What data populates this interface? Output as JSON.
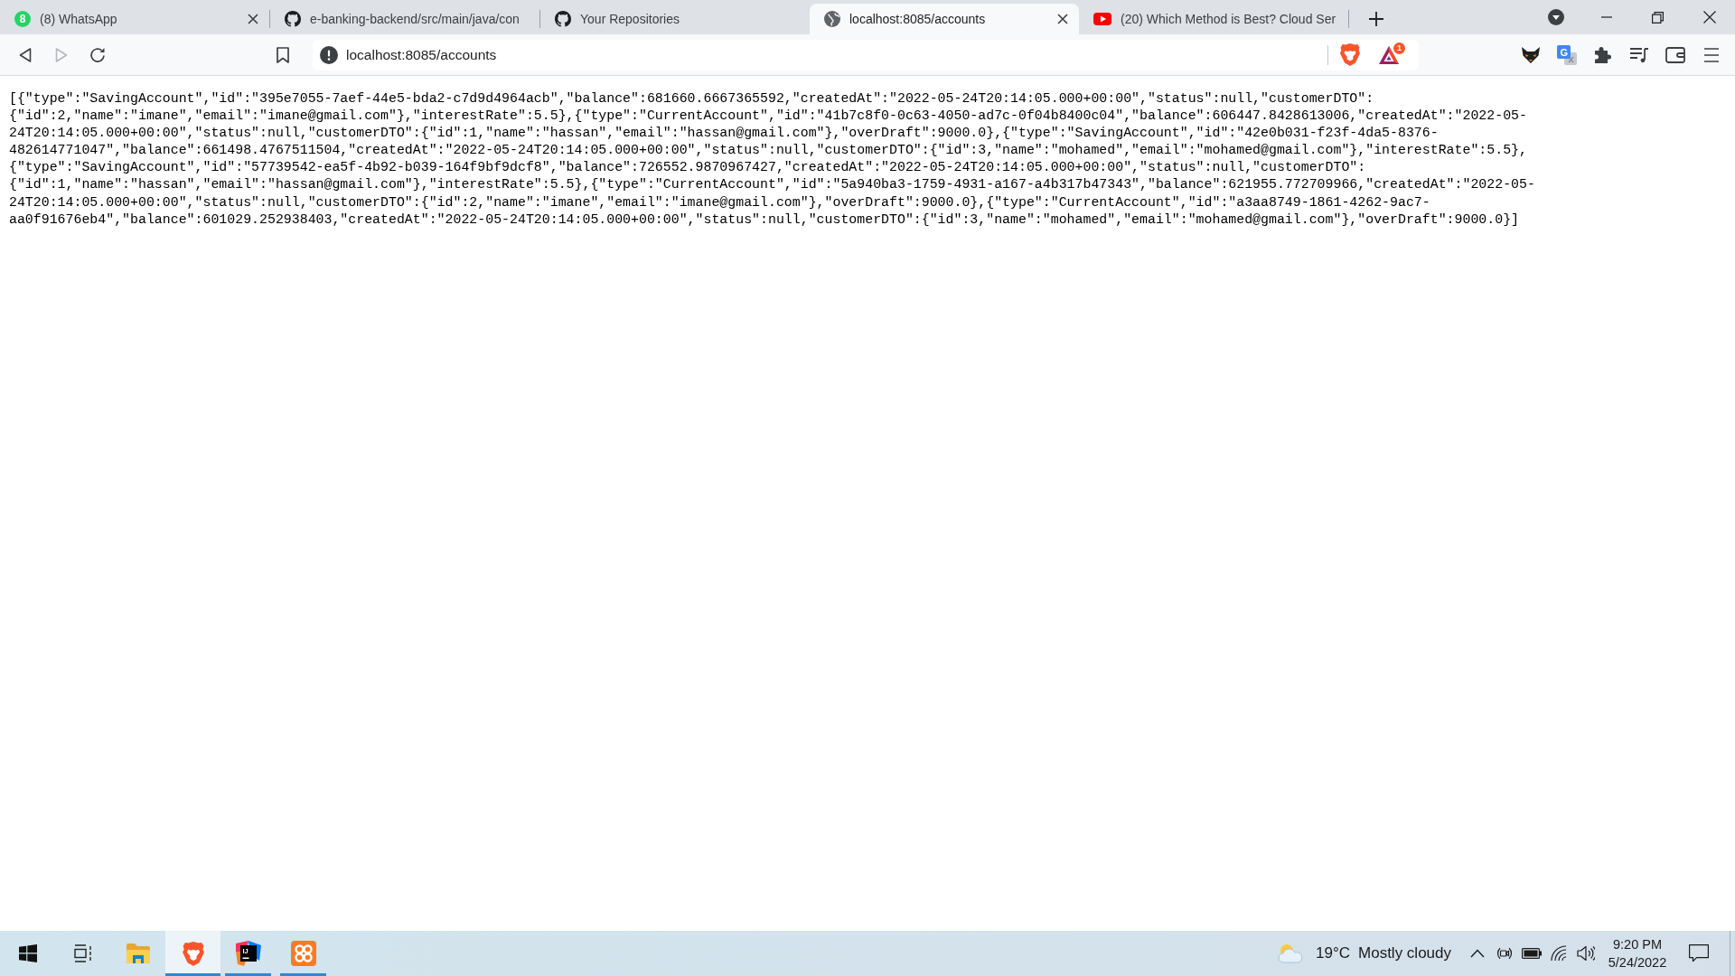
{
  "tabs": [
    {
      "kind": "whatsapp",
      "badge": "8",
      "title": "(8) WhatsApp",
      "selected": false,
      "closable": true
    },
    {
      "kind": "github",
      "title": "e-banking-backend/src/main/java/con",
      "selected": false,
      "closable": false
    },
    {
      "kind": "github",
      "title": "Your Repositories",
      "selected": false,
      "closable": false
    },
    {
      "kind": "globe",
      "title": "localhost:8085/accounts",
      "selected": true,
      "closable": true
    },
    {
      "kind": "youtube",
      "title": "(20) Which Method is Best? Cloud Ser",
      "selected": false,
      "closable": false
    }
  ],
  "toolbar": {
    "navigation": [
      {
        "kind": "back",
        "disabled": false
      },
      {
        "kind": "forward",
        "disabled": true
      },
      {
        "kind": "reload",
        "disabled": false
      }
    ],
    "address": {
      "value": "localhost:8085/accounts"
    },
    "rewards_badge": "1",
    "extensions": [
      {
        "kind": "fox"
      },
      {
        "kind": "translate",
        "icon_text": "G"
      },
      {
        "kind": "puzzle"
      },
      {
        "kind": "playlist"
      },
      {
        "kind": "wallet"
      },
      {
        "kind": "menu"
      }
    ]
  },
  "page": {
    "lines": [
      "[{\"type\":\"SavingAccount\",\"id\":\"395e7055-7aef-44e5-bda2-c7d9d4964acb\",\"balance\":681660.6667365592,\"createdAt\":\"2022-05-24T20:14:05.000+00:00\",\"status\":null,\"customerDTO\":",
      "{\"id\":2,\"name\":\"imane\",\"email\":\"imane@gmail.com\"},\"interestRate\":5.5},{\"type\":\"CurrentAccount\",\"id\":\"41b7c8f0-0c63-4050-ad7c-0f04b8400c04\",\"balance\":606447.8428613006,\"createdAt\":\"2022-05-",
      "24T20:14:05.000+00:00\",\"status\":null,\"customerDTO\":{\"id\":1,\"name\":\"hassan\",\"email\":\"hassan@gmail.com\"},\"overDraft\":9000.0},{\"type\":\"SavingAccount\",\"id\":\"42e0b031-f23f-4da5-8376-",
      "482614771047\",\"balance\":661498.4767511504,\"createdAt\":\"2022-05-24T20:14:05.000+00:00\",\"status\":null,\"customerDTO\":{\"id\":3,\"name\":\"mohamed\",\"email\":\"mohamed@gmail.com\"},\"interestRate\":5.5},",
      "{\"type\":\"SavingAccount\",\"id\":\"57739542-ea5f-4b92-b039-164f9bf9dcf8\",\"balance\":726552.9870967427,\"createdAt\":\"2022-05-24T20:14:05.000+00:00\",\"status\":null,\"customerDTO\":",
      "{\"id\":1,\"name\":\"hassan\",\"email\":\"hassan@gmail.com\"},\"interestRate\":5.5},{\"type\":\"CurrentAccount\",\"id\":\"5a940ba3-1759-4931-a167-a4b317b47343\",\"balance\":621955.772709966,\"createdAt\":\"2022-05-",
      "24T20:14:05.000+00:00\",\"status\":null,\"customerDTO\":{\"id\":2,\"name\":\"imane\",\"email\":\"imane@gmail.com\"},\"overDraft\":9000.0},{\"type\":\"CurrentAccount\",\"id\":\"a3aa8749-1861-4262-9ac7-",
      "aa0f91676eb4\",\"balance\":601029.252938403,\"createdAt\":\"2022-05-24T20:14:05.000+00:00\",\"status\":null,\"customerDTO\":{\"id\":3,\"name\":\"mohamed\",\"email\":\"mohamed@gmail.com\"},\"overDraft\":9000.0}]"
    ]
  },
  "taskbar": {
    "apps": [
      {
        "kind": "start",
        "selected": false,
        "running": false
      },
      {
        "kind": "taskview",
        "selected": false,
        "running": false
      },
      {
        "kind": "files",
        "selected": false,
        "running": false
      },
      {
        "kind": "lion",
        "selected": true,
        "running": true
      },
      {
        "kind": "ide",
        "icon_text": "IJ",
        "selected": false,
        "running": true
      },
      {
        "kind": "xampp",
        "selected": false,
        "running": true
      }
    ],
    "weather": {
      "temperature": "19°C",
      "condition": "Mostly cloudy"
    },
    "clock": {
      "time": "9:20 PM",
      "date": "5/24/2022"
    }
  }
}
